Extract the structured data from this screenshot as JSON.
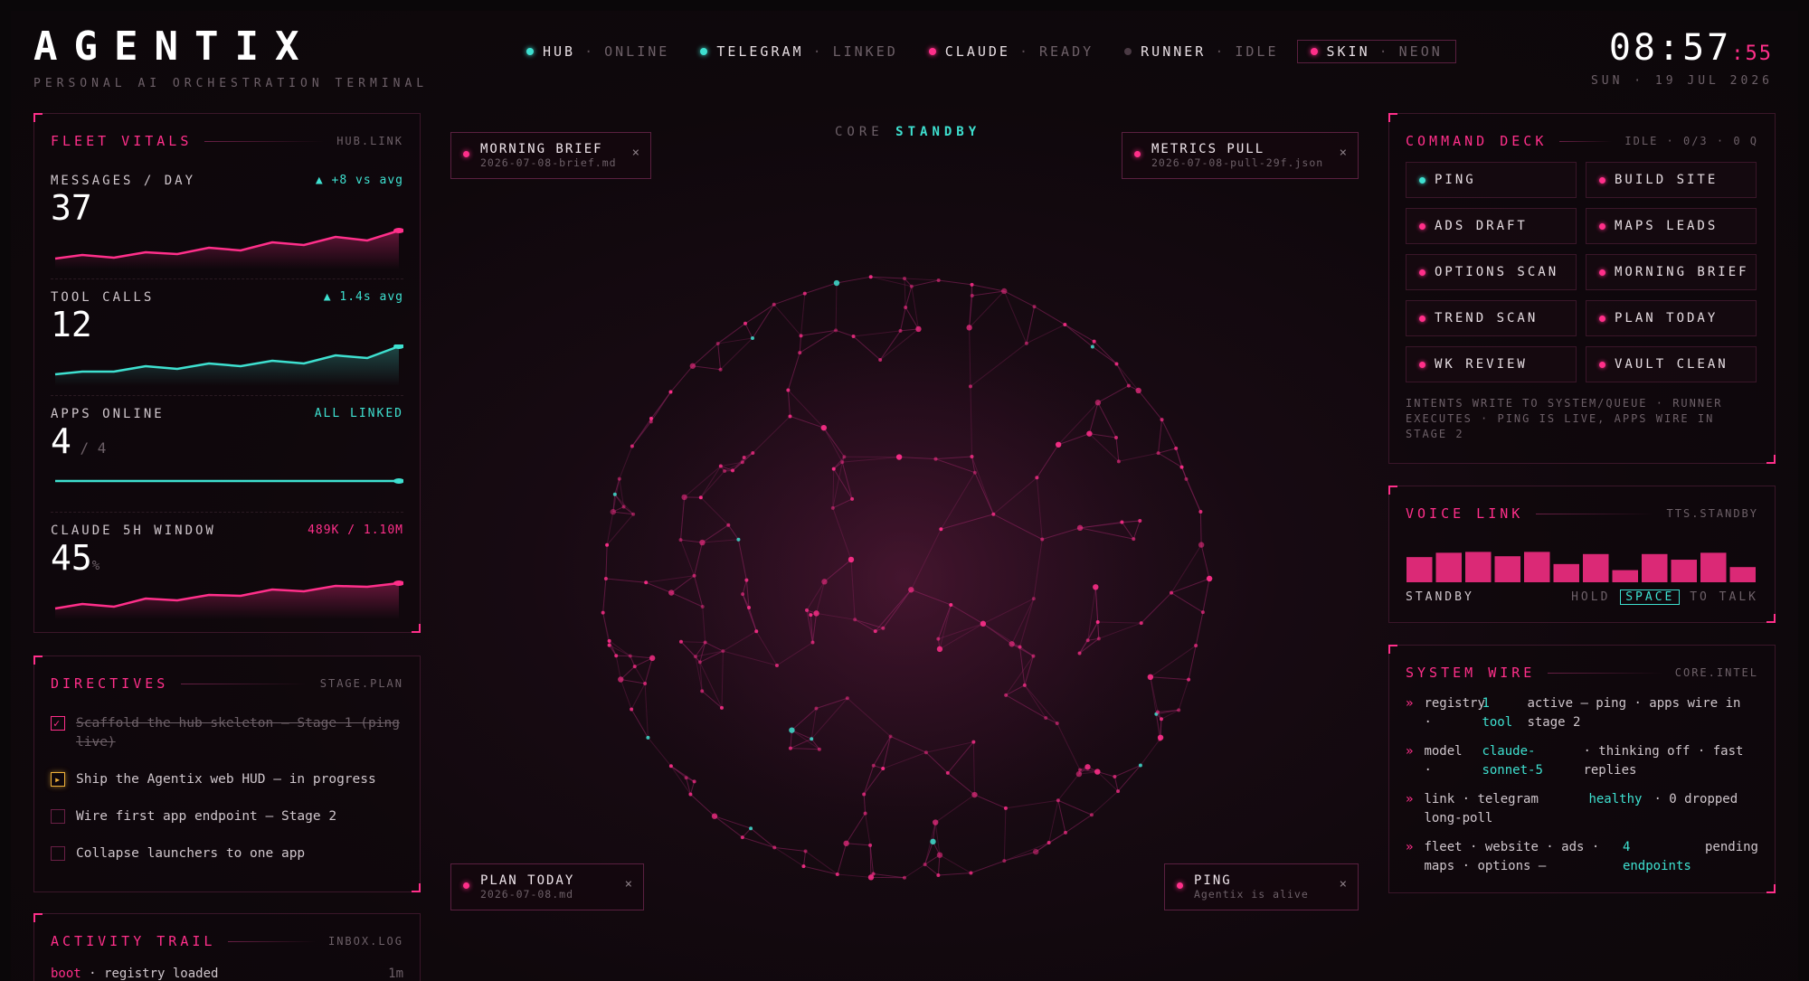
{
  "brand": {
    "name": "AGENTIX",
    "subtitle": "PERSONAL AI ORCHESTRATION TERMINAL"
  },
  "status_strip": [
    {
      "label": "HUB",
      "value": "ONLINE",
      "color": "#3ee0d0"
    },
    {
      "label": "TELEGRAM",
      "value": "LINKED",
      "color": "#3ee0d0"
    },
    {
      "label": "CLAUDE",
      "value": "READY",
      "color": "#ff2f8a"
    },
    {
      "label": "RUNNER",
      "value": "IDLE",
      "color": "#4a3a44"
    },
    {
      "label": "SKIN",
      "value": "NEON",
      "color": "#ff2f8a"
    }
  ],
  "clock": {
    "time": "08:57",
    "seconds": ":55",
    "date": "SUN · 19 JUL 2026"
  },
  "fleet_vitals": {
    "title": "FLEET VITALS",
    "tag": "HUB.LINK",
    "metrics": [
      {
        "label": "MESSAGES / DAY",
        "note": "▲ +8 vs avg",
        "value": "37",
        "sub": "",
        "suffix": ""
      },
      {
        "label": "TOOL CALLS",
        "note": "▲ 1.4s avg",
        "value": "12",
        "sub": "",
        "suffix": ""
      },
      {
        "label": "APPS ONLINE",
        "note": "ALL LINKED",
        "value": "4",
        "sub": "/ 4",
        "suffix": ""
      },
      {
        "label": "CLAUDE 5H WINDOW",
        "note": "489K / 1.10M",
        "value": "45",
        "sub": "",
        "suffix": "%"
      }
    ]
  },
  "directives": {
    "title": "DIRECTIVES",
    "tag": "STAGE.PLAN",
    "items": [
      {
        "text": "Scaffold the hub skeleton — Stage 1 (ping live)",
        "state": "done"
      },
      {
        "text": "Ship the Agentix web HUD — in progress",
        "state": "progress"
      },
      {
        "text": "Wire first app endpoint — Stage 2",
        "state": "todo"
      },
      {
        "text": "Collapse launchers to one app",
        "state": "todo"
      }
    ]
  },
  "activity_trail": {
    "title": "ACTIVITY TRAIL",
    "tag": "INBOX.LOG",
    "entries": [
      {
        "key": "boot",
        "text": "· registry loaded",
        "age": "1m"
      }
    ]
  },
  "core": {
    "label": "CORE",
    "state": "STANDBY"
  },
  "chips": {
    "morning_brief": {
      "title": "MORNING BRIEF",
      "sub": "2026-07-08-brief.md",
      "close": "×"
    },
    "metrics_pull": {
      "title": "METRICS PULL",
      "sub": "2026-07-08-pull-29f.json",
      "close": "×"
    },
    "plan_today": {
      "title": "PLAN TODAY",
      "sub": "2026-07-08.md",
      "close": "×"
    },
    "ping": {
      "title": "PING",
      "sub": "Agentix is alive",
      "close": "×"
    }
  },
  "command_deck": {
    "title": "COMMAND DECK",
    "tag": "IDLE · 0/3 · 0 Q",
    "commands": [
      "PING",
      "BUILD SITE",
      "ADS DRAFT",
      "MAPS LEADS",
      "OPTIONS SCAN",
      "MORNING BRIEF",
      "TREND SCAN",
      "PLAN TODAY",
      "WK REVIEW",
      "VAULT CLEAN"
    ],
    "note": "INTENTS WRITE TO SYSTEM/QUEUE · RUNNER EXECUTES · PING IS LIVE, APPS WIRE IN STAGE 2"
  },
  "voice_link": {
    "title": "VOICE LINK",
    "tag": "TTS.STANDBY",
    "levels": [
      0.58,
      0.68,
      0.7,
      0.6,
      0.7,
      0.42,
      0.65,
      0.28,
      0.65,
      0.52,
      0.68,
      0.35
    ],
    "state": "STANDBY",
    "hint_pre": "HOLD",
    "key": "SPACE",
    "hint_post": "TO TALK"
  },
  "system_wire": {
    "title": "SYSTEM WIRE",
    "tag": "CORE.INTEL",
    "rows": [
      {
        "key": "registry ·",
        "val": "1 tool",
        "desc": "active — ping · apps wire in stage 2"
      },
      {
        "key": "model ·",
        "val": "claude-sonnet-5",
        "desc": "· thinking off · fast replies"
      },
      {
        "key": "link · telegram long-poll",
        "val": "healthy",
        "desc": "· 0 dropped"
      },
      {
        "key": "fleet · website · ads · maps · options —",
        "val": "4 endpoints",
        "desc": "pending"
      }
    ]
  },
  "colors": {
    "accent": "#ff2f8a",
    "teal": "#3ee0d0",
    "amber": "#f0b23a"
  }
}
